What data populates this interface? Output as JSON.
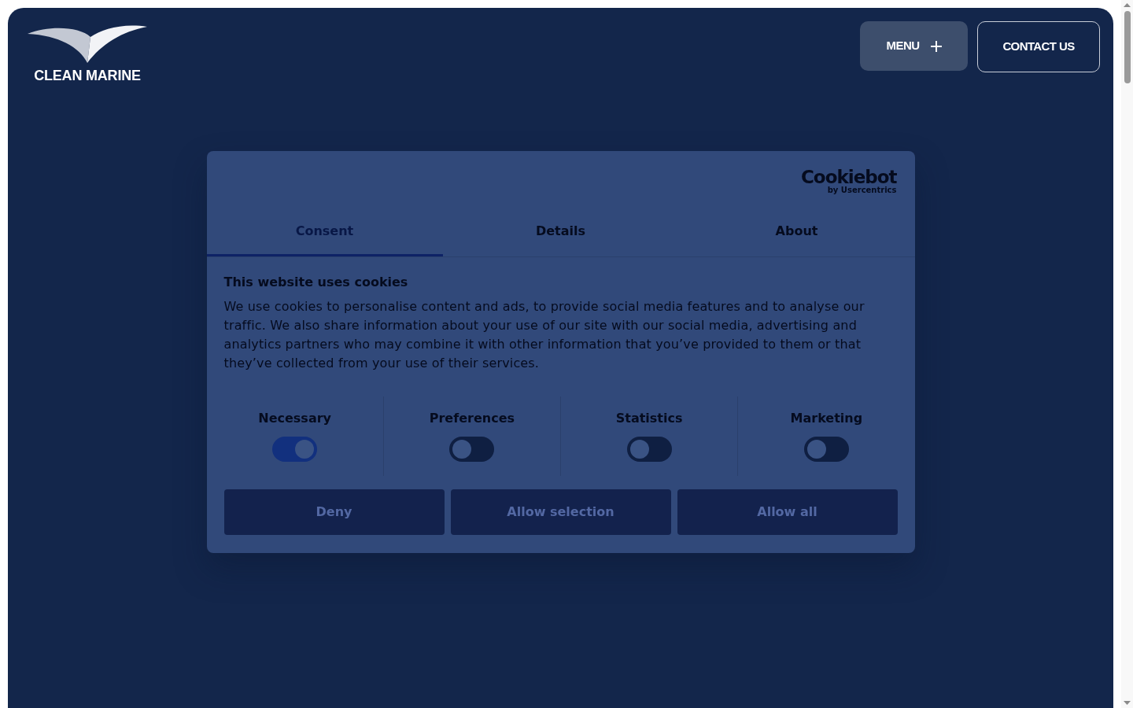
{
  "header": {
    "logo": {
      "text": "CLEAN MARINE"
    },
    "buttons": [
      {
        "kind": "filled",
        "label": "MENU"
      },
      {
        "kind": "outline",
        "label": "CONTACT US"
      }
    ]
  },
  "cookie_dialog": {
    "brand": {
      "name": "Cookiebot",
      "byline": "by Usercentrics"
    },
    "tabs": [
      {
        "label": "Consent",
        "selected": true
      },
      {
        "label": "Details",
        "selected": false
      },
      {
        "label": "About",
        "selected": false
      }
    ],
    "title": "This website uses cookies",
    "body": "We use cookies to personalise content and ads, to provide social media features and to analyse our traffic. We also share information about your use of our site with our social media, advertising and analytics partners who may combine it with other information that you’ve provided to them or that they’ve collected from your use of their services.",
    "categories": [
      {
        "label": "Necessary",
        "on": true
      },
      {
        "label": "Preferences",
        "on": false
      },
      {
        "label": "Statistics",
        "on": false
      },
      {
        "label": "Marketing",
        "on": false
      }
    ],
    "buttons": [
      "Deny",
      "Allow selection",
      "Allow all"
    ]
  }
}
